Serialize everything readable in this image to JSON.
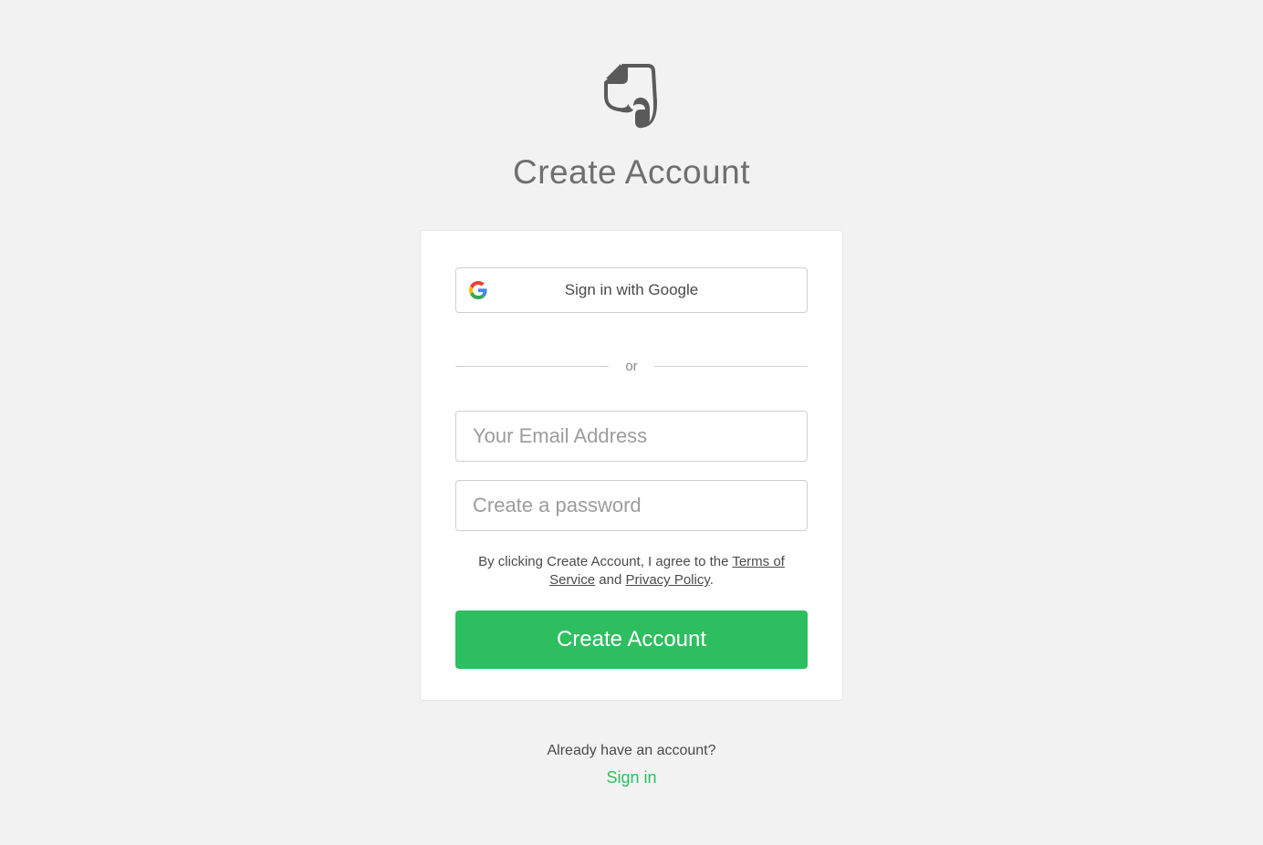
{
  "page_title": "Create Account",
  "google_button_label": "Sign in with Google",
  "or_label": "or",
  "email_placeholder": "Your Email Address",
  "password_placeholder": "Create a password",
  "terms": {
    "prefix": "By clicking Create Account, I agree to the ",
    "terms_link": "Terms of Service",
    "middle": " and ",
    "privacy_link": "Privacy Policy",
    "suffix": "."
  },
  "create_button_label": "Create Account",
  "already_text": "Already have an account?",
  "signin_label": "Sign in",
  "colors": {
    "accent": "#2dbe60",
    "background": "#f2f2f2"
  }
}
